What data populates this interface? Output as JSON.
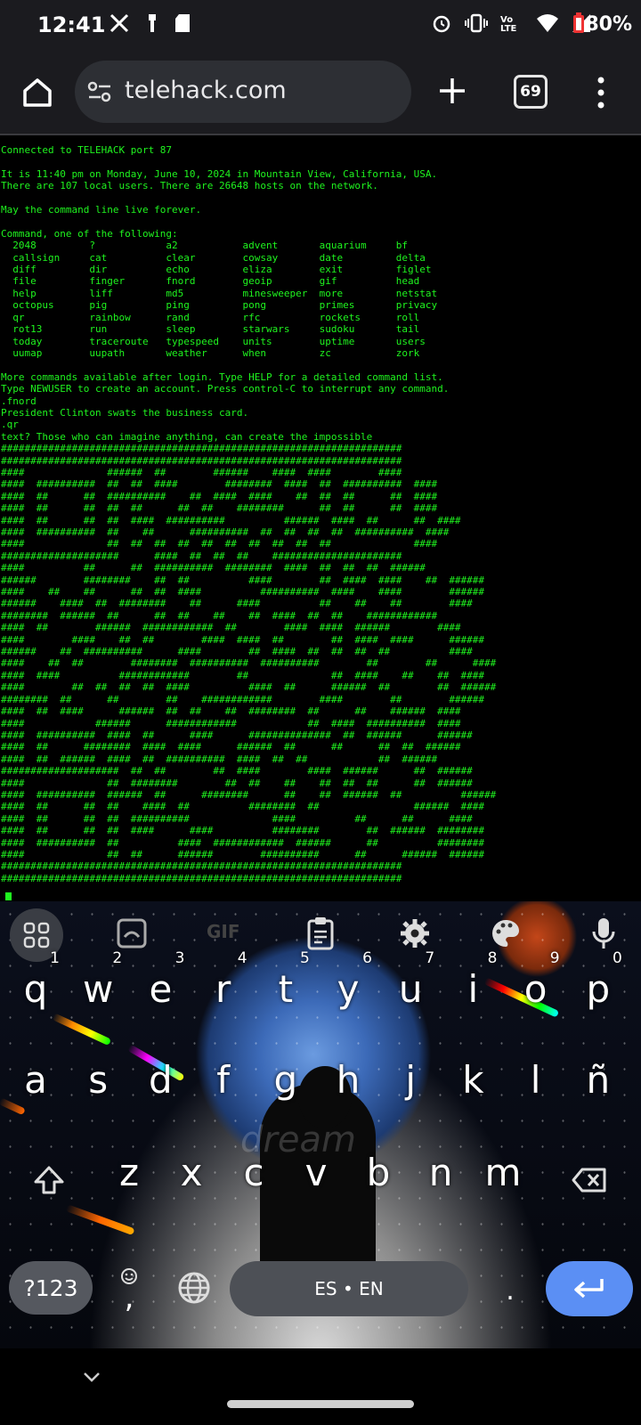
{
  "status_bar": {
    "time": "12:41",
    "battery": "80%",
    "icons_left": [
      "x-logo-icon",
      "usb-icon",
      "sd-card-icon"
    ],
    "icons_right": [
      "alarm-icon",
      "vibrate-icon",
      "volte-icon",
      "wifi-icon",
      "signal-icon",
      "battery-icon"
    ],
    "volte_label": "Vo LTE"
  },
  "browser": {
    "url": "telehack.com",
    "tab_count": "69"
  },
  "terminal": {
    "lines": [
      "Connected to TELEHACK port 87",
      "",
      "It is 11:40 pm on Monday, June 10, 2024 in Mountain View, California, USA.",
      "There are 107 local users. There are 26648 hosts on the network.",
      "",
      "May the command line live forever.",
      "",
      "Command, one of the following:",
      "  2048         ?            a2           advent       aquarium     bf",
      "  callsign     cat          clear        cowsay       date         delta",
      "  diff         dir          echo         eliza        exit         figlet",
      "  file         finger       fnord        geoip        gif          head",
      "  help         liff         md5          minesweeper  more         netstat",
      "  octopus      pig          ping         pong         primes       privacy",
      "  qr           rainbow      rand         rfc          rockets      roll",
      "  rot13        run          sleep        starwars     sudoku       tail",
      "  today        traceroute   typespeed    units        uptime       users",
      "  uumap        uupath       weather      when         zc           zork",
      "",
      "More commands available after login. Type HELP for a detailed command list.",
      "Type NEWUSER to create an account. Press control-C to interrupt any command.",
      ".fnord",
      "President Clinton swats the business card.",
      ".qr",
      "text? Those who can imagine anything, can create the impossible",
      "####################################################################",
      "####################################################################",
      "####              ######  ##        ######    ####  ####        ####",
      "####  ##########  ##  ##  ####        ########  ####  ##  ##########  ####",
      "####  ##      ##  ##########    ##  ####  ####    ##  ##  ##      ##  ####",
      "####  ##      ##  ##  ##      ##  ##    ########      ##  ##      ##  ####",
      "####  ##      ##  ##  ####  ##########          ######  ####  ##      ##  ####",
      "####  ##########  ##    ##      ##########  ##  ##  ##  ##  ##########  ####",
      "####              ##  ##  ##  ##  ##  ##  ##  ##  ##  ##              ####",
      "####################      ####  ##  ##  ##    ######################",
      "####          ##      ##  ##########  ########  ####  ##  ##  ##  ######",
      "######        ########    ##  ##          ####        ##  ####  ####    ##  ######",
      "####    ##    ##      ##  ##  ####          ##########  ####    ####        ######",
      "######    ####  ##  ########    ##      ####          ##    ##    ##        ####",
      "########  ######  ##      ##  ##    ##    ##  ####  ##  ##    ############",
      "####  ##        ######  ############  ##        ####  ####  ######        ####",
      "####        ####    ##  ##        ####  ####  ##        ##  ####  ####      ######",
      "######    ##  ##########      ####        ##  ####  ##  ##  ##  ##          ####",
      "####    ##  ##        ########  ##########  ##########        ##        ##      ####",
      "####  ####          ############        ##              ##  ####    ##    ##  ####",
      "####        ##  ##  ##  ##  ####          ####  ##      ######  ##        ##  ######",
      "########  ##      ##        ##    ############        ####        ##        ######",
      "####  ##  ####      ######  ##  ##    ##  ########  ##      ##    ######  ####",
      "####            ######      ############            ##  ####  ##########  ####",
      "####  ##########  ####  ##      ####      ##############  ##  ######      ######",
      "####  ##      ########  ####  ####      ######  ##      ##      ##  ##  ######",
      "####  ##  ######  ####  ##  ##########  ####  ##  ##            ##  ######",
      "####################  ##  ##        ##  ####        ####  ######      ##  ######",
      "####              ##  ########        ##  ##    ##    ##  ##  ##      ##  ######",
      "####  ##########  ######  ##      ########      ##    ##  ######  ##          ######",
      "####  ##      ##  ##    ####  ##          ########  ##                ######  ####",
      "####  ##      ##  ##  ##########              ####          ##      ##      ####",
      "####  ##      ##  ##  ####      ####          ########        ##  ######  ########",
      "####  ##########  ##          ####  ############  ######      ##          ########",
      "####              ##  ##      ######        ##########      ##      ######  ######",
      "####################################################################",
      "####################################################################"
    ]
  },
  "keyboard": {
    "toolbar": [
      "apps-grid-icon",
      "sticker-icon",
      "gif-icon",
      "clipboard-icon",
      "settings-icon",
      "palette-icon",
      "mic-icon"
    ],
    "gif_label": "GIF",
    "row1": [
      {
        "key": "q",
        "num": "1"
      },
      {
        "key": "w",
        "num": "2"
      },
      {
        "key": "e",
        "num": "3"
      },
      {
        "key": "r",
        "num": "4"
      },
      {
        "key": "t",
        "num": "5"
      },
      {
        "key": "y",
        "num": "6"
      },
      {
        "key": "u",
        "num": "7"
      },
      {
        "key": "i",
        "num": "8"
      },
      {
        "key": "o",
        "num": "9"
      },
      {
        "key": "p",
        "num": "0"
      }
    ],
    "row2": [
      "a",
      "s",
      "d",
      "f",
      "g",
      "h",
      "j",
      "k",
      "l",
      "ñ"
    ],
    "row3": [
      "z",
      "x",
      "c",
      "v",
      "b",
      "n",
      "m"
    ],
    "symbols_label": "?123",
    "space_label": "ES • EN",
    "comma": ",",
    "period": ".",
    "background_word": "dream"
  }
}
